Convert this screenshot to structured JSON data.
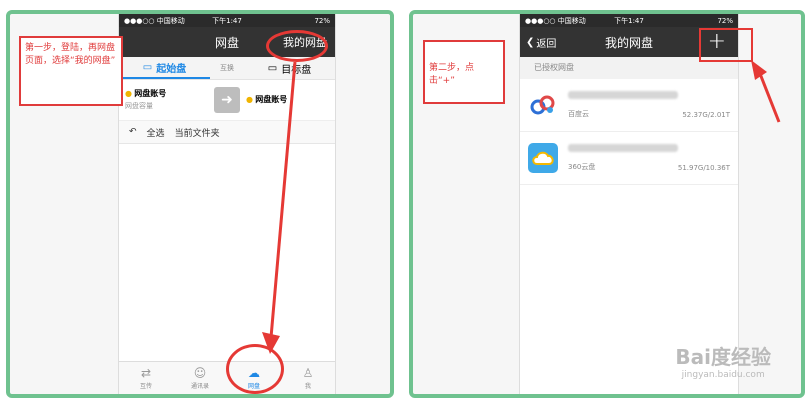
{
  "colors": {
    "panel_border": "#6fc28f",
    "navbar": "#333333",
    "accent": "#1e88e5",
    "annotation": "#e03b3b"
  },
  "status": {
    "carrier": "●●●○○ 中国移动",
    "time": "下午1:47",
    "battery_left": "72%",
    "battery_right": "72%"
  },
  "left": {
    "navbar": {
      "title": "网盘",
      "right": "我的网盘"
    },
    "tabs": {
      "source": "起始盘",
      "swap": "互换",
      "target": "目标盘"
    },
    "accounts": [
      {
        "name": "网盘账号",
        "sub": "网盘容量"
      },
      {
        "name": "网盘账号",
        "sub": ""
      }
    ],
    "toolbar": {
      "back": "↶",
      "select_all": "全选",
      "current_folder": "当前文件夹"
    },
    "tabbar": [
      {
        "label": "互传",
        "icon": "transfer-icon"
      },
      {
        "label": "通讯录",
        "icon": "contacts-icon"
      },
      {
        "label": "网盘",
        "icon": "cloud-icon"
      },
      {
        "label": "我",
        "icon": "me-icon"
      }
    ],
    "note": "第一步，登陆，再网盘页面，选择“我的网盘”"
  },
  "right": {
    "navbar": {
      "back": "返回",
      "title": "我的网盘",
      "action": "+"
    },
    "section": "已授权网盘",
    "disks": [
      {
        "name": "百度云",
        "capacity": "52.37G/2.01T",
        "logo": "baidu-cloud-icon"
      },
      {
        "name": "360云盘",
        "capacity": "51.97G/10.36T",
        "logo": "360-cloud-icon"
      }
    ],
    "note": "第二步，点击“+”"
  },
  "watermark": {
    "main": "Bai度经验",
    "sub": "jingyan.baidu.com"
  }
}
